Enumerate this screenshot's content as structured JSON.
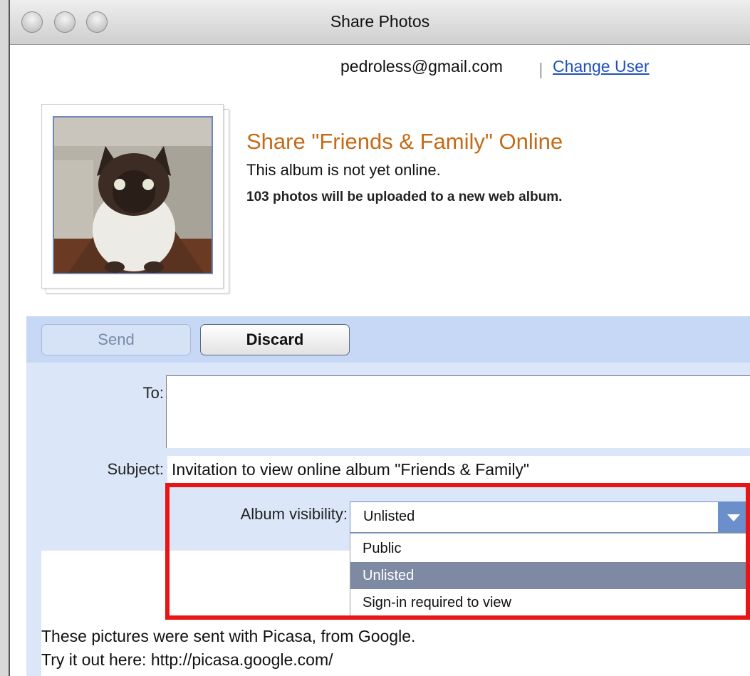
{
  "window": {
    "title": "Share Photos"
  },
  "user": {
    "email": "pedroless@gmail.com",
    "change_user_label": "Change User"
  },
  "album": {
    "title": "Share \"Friends & Family\" Online",
    "status": "This album is not yet online.",
    "upload_info": "103 photos will be uploaded to a new web album."
  },
  "toolbar": {
    "send_label": "Send",
    "discard_label": "Discard"
  },
  "form": {
    "to_label": "To:",
    "to_value": "",
    "subject_label": "Subject:",
    "subject_value": "Invitation to view online album \"Friends & Family\"",
    "visibility_label": "Album visibility:",
    "visibility_selected": "Unlisted",
    "visibility_options": [
      "Public",
      "Unlisted",
      "Sign-in required to view"
    ]
  },
  "message": {
    "line1": "These pictures were sent with Picasa, from Google.",
    "line2": "Try it out here: http://picasa.google.com/"
  },
  "colors": {
    "accent": "#c56a16",
    "toolbar_bg": "#c7d8f6",
    "form_bg": "#dbe7f9",
    "dropdown_selected": "#7e8aa4",
    "highlight": "#ea1414"
  }
}
